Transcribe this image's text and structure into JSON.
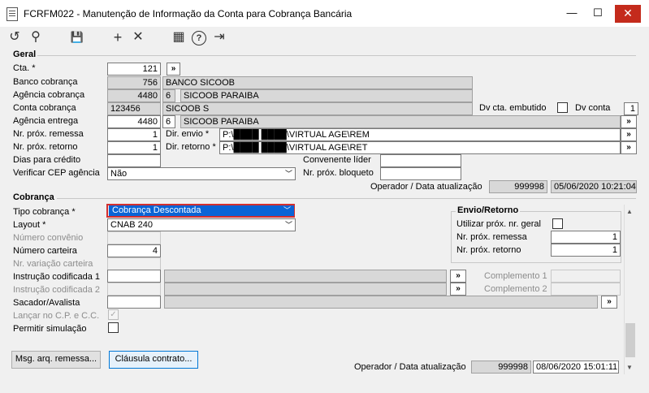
{
  "window": {
    "title": "FCRFM022 - Manutenção de Informação da Conta para Cobrança Bancária",
    "minimize": "—",
    "maximize": "☐",
    "close": "✕"
  },
  "toolbar": {
    "refresh": "↺",
    "search": "⚲",
    "save": "💾",
    "add": "+",
    "remove": "✕",
    "calendar": "▦",
    "help": "?",
    "exit": "⇥"
  },
  "geral": {
    "section_title": "Geral",
    "cta_label": "Cta. *",
    "cta_value": "121",
    "cta_btn": "»",
    "banco_label": "Banco cobrança",
    "banco_code": "756",
    "banco_name": "BANCO SICOOB",
    "agencia_label": "Agência cobrança",
    "agencia_code": "4480",
    "agencia_dv": "6",
    "agencia_name": "SICOOB PARAIBA",
    "conta_label": "Conta cobrança",
    "conta_code": "123456",
    "conta_name": "SICOOB S",
    "dv_embutido_label": "Dv cta. embutido",
    "dv_conta_label": "Dv conta",
    "dv_conta_value": "1",
    "ag_entrega_label": "Agência entrega",
    "ag_entrega_code": "4480",
    "ag_entrega_dv": "6",
    "ag_entrega_name": "SICOOB PARAIBA",
    "remessa_label": "Nr. próx. remessa",
    "remessa_value": "1",
    "retorno_label": "Nr. próx. retorno",
    "retorno_value": "1",
    "dir_envio_label": "Dir. envio *",
    "dir_envio_value": "P:\\████ ████\\VIRTUAL AGE\\REM",
    "dir_retorno_label": "Dir. retorno *",
    "dir_retorno_value": "P:\\████ ████\\VIRTUAL AGE\\RET",
    "dias_label": "Dias para crédito",
    "convenente_label": "Convenente líder",
    "cep_label": "Verificar CEP agência",
    "cep_value": "Não",
    "bloqueto_label": "Nr. próx. bloqueto",
    "operador_label": "Operador / Data atualização",
    "operador_value": "999998",
    "data_value": "05/06/2020 10:21:04",
    "btn": "»"
  },
  "cobranca": {
    "section_title": "Cobrança",
    "tipo_label": "Tipo cobrança *",
    "tipo_value": "Cobrança Descontada",
    "layout_label": "Layout *",
    "layout_value": "CNAB 240",
    "convenio_label": "Número convênio",
    "carteira_label": "Número carteira",
    "carteira_value": "4",
    "variacao_label": "Nr. variação carteira",
    "instr1_label": "Instrução codificada 1",
    "instr2_label": "Instrução codificada 2",
    "compl1_label": "Complemento 1",
    "compl2_label": "Complemento 2",
    "sacador_label": "Sacador/Avalista",
    "lancar_label": "Lançar no C.P. e C.C.",
    "simulacao_label": "Permitir simulação",
    "msg_btn": "Msg. arq. remessa...",
    "clausula_btn": "Cláusula contrato...",
    "operador_label": "Operador / Data atualização",
    "operador_value": "999998",
    "data_value": "08/06/2020 15:01:11",
    "btn": "»"
  },
  "envio": {
    "section_title": "Envio/Retorno",
    "utilizar_label": "Utilizar próx. nr. geral",
    "remessa_label": "Nr. próx. remessa",
    "remessa_value": "1",
    "retorno_label": "Nr. próx. retorno",
    "retorno_value": "1"
  },
  "scroll": {
    "up": "▲",
    "down": "▼"
  }
}
